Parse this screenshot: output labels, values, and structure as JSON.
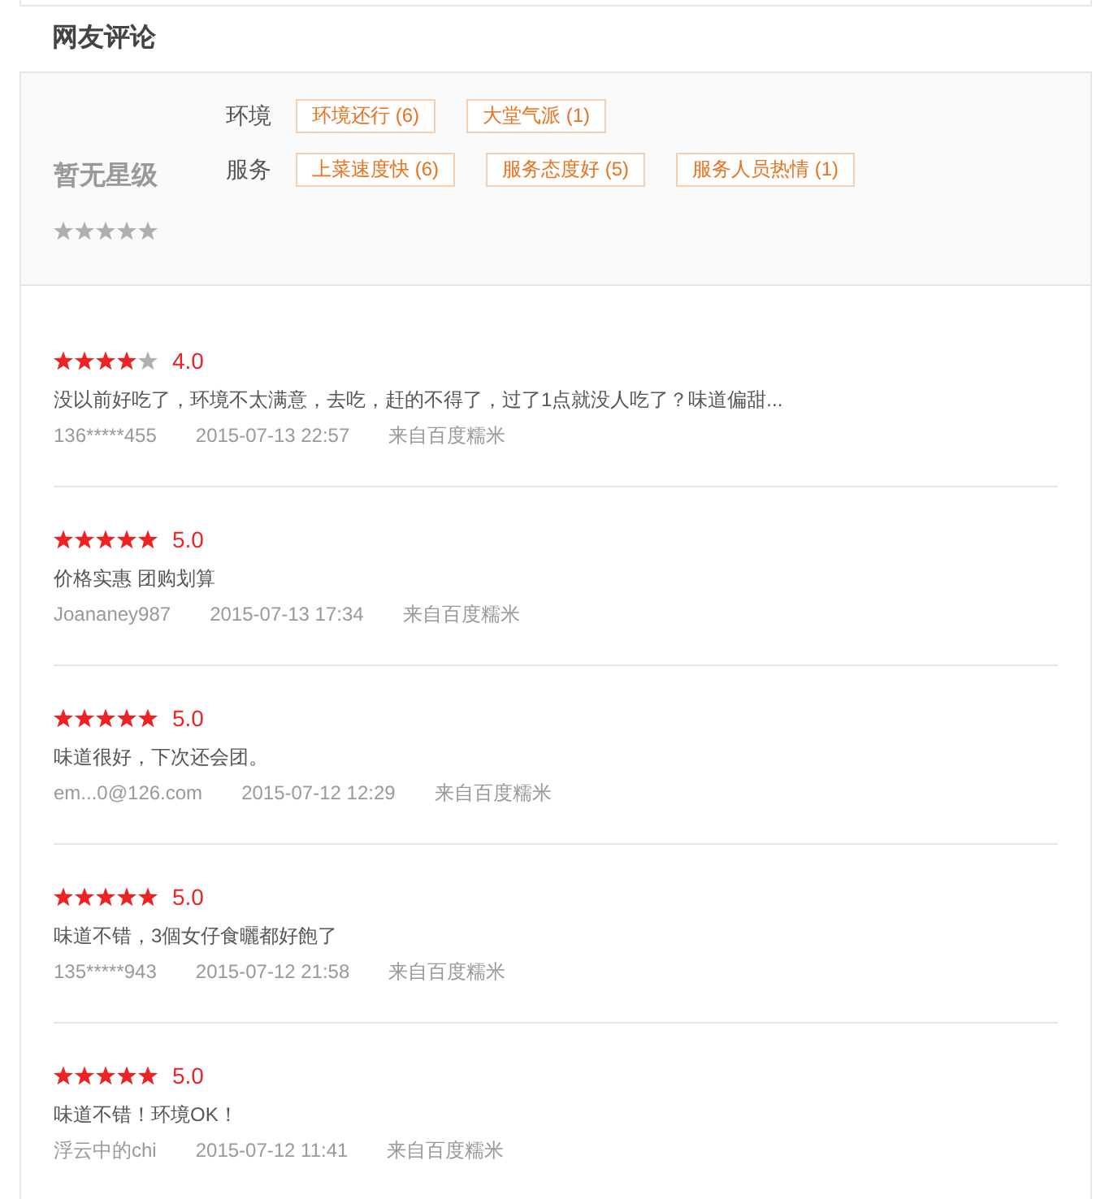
{
  "section": {
    "title": "网友评论"
  },
  "summary": {
    "rating_text": "暂无星级",
    "stars": 0,
    "tag_groups": [
      {
        "label": "环境",
        "tags": [
          "环境还行 (6)",
          "大堂气派 (1)"
        ]
      },
      {
        "label": "服务",
        "tags": [
          "上菜速度快 (6)",
          "服务态度好 (5)",
          "服务人员热情 (1)"
        ]
      }
    ]
  },
  "reviews": [
    {
      "stars": 4,
      "score": "4.0",
      "text": "没以前好吃了，环境不太满意，去吃，赶的不得了，过了1点就没人吃了？味道偏甜...",
      "user": "136*****455",
      "time": "2015-07-13 22:57",
      "source": "来自百度糯米"
    },
    {
      "stars": 5,
      "score": "5.0",
      "text": "价格实惠 团购划算",
      "user": "Joananey987",
      "time": "2015-07-13 17:34",
      "source": "来自百度糯米"
    },
    {
      "stars": 5,
      "score": "5.0",
      "text": "味道很好，下次还会团。",
      "user": "em...0@126.com",
      "time": "2015-07-12 12:29",
      "source": "来自百度糯米"
    },
    {
      "stars": 5,
      "score": "5.0",
      "text": "味道不错，3個女仔食曬都好飽了",
      "user": "135*****943",
      "time": "2015-07-12 21:58",
      "source": "来自百度糯米"
    },
    {
      "stars": 5,
      "score": "5.0",
      "text": "味道不错！环境OK！",
      "user": "浮云中的chi",
      "time": "2015-07-12 11:41",
      "source": "来自百度糯米"
    }
  ]
}
